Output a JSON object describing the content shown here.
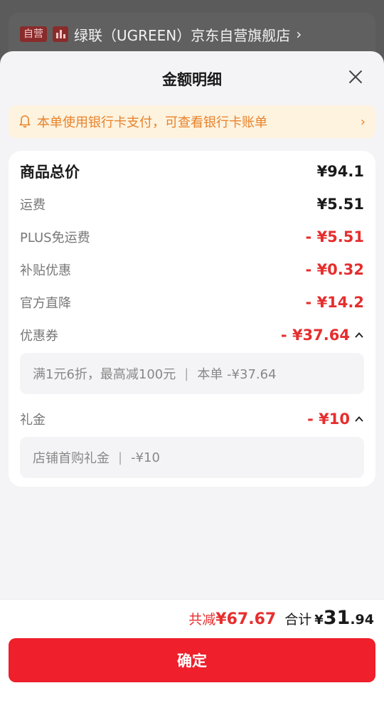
{
  "background": {
    "store": {
      "badge": "自营",
      "name": "绿联（UGREEN）京东自营旗舰店",
      "chevron": "›"
    }
  },
  "sheet": {
    "title": "金额明细",
    "close_icon": "close-icon"
  },
  "notice": {
    "icon": "bell-icon",
    "text": "本单使用银行卡支付，可查看银行卡账单",
    "chevron": "›"
  },
  "details": {
    "goods_total": {
      "label": "商品总价",
      "value": "¥94.1"
    },
    "shipping": {
      "label": "运费",
      "value": "¥5.51"
    },
    "plus_free_shipping": {
      "label": "PLUS免运费",
      "value": "- ¥5.51"
    },
    "subsidy": {
      "label": "补贴优惠",
      "value": "- ¥0.32"
    },
    "official_discount": {
      "label": "官方直降",
      "value": "- ¥14.2"
    },
    "coupon": {
      "label": "优惠券",
      "value": "- ¥37.64",
      "detail_rule": "满1元6折，最高减100元",
      "detail_separator": "|",
      "detail_amount": "本单 -¥37.64"
    },
    "gift_money": {
      "label": "礼金",
      "value": "- ¥10",
      "detail_name": "店铺首购礼金",
      "detail_separator": "|",
      "detail_amount": "-¥10"
    }
  },
  "footer": {
    "reduce_label": "共减",
    "reduce_value": "¥67.67",
    "total_label": "合计",
    "total_currency": "¥",
    "total_int": "31",
    "total_dec": ".94",
    "confirm_label": "确定"
  },
  "colors": {
    "accent_red": "#ef1f2b",
    "discount_red": "#e62e2e",
    "notice_orange": "#e8822a",
    "notice_bg": "#fdf3df"
  }
}
